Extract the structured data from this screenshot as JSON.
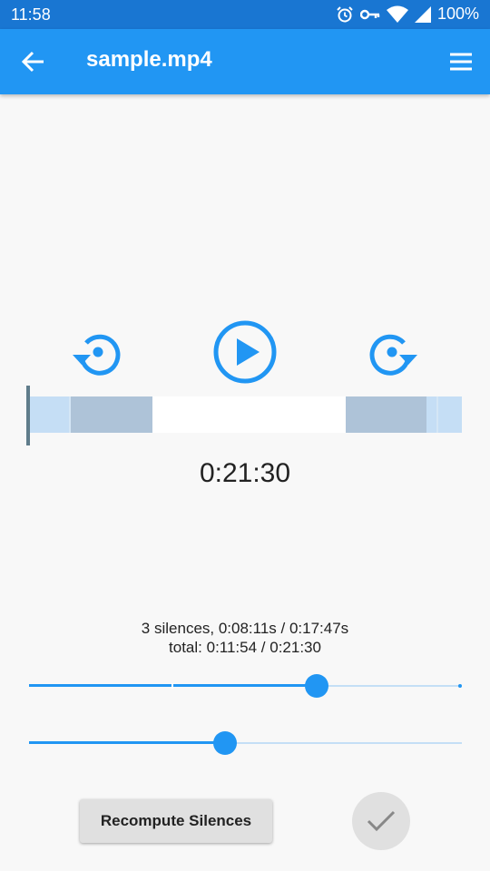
{
  "status_bar": {
    "time": "11:58",
    "battery": "100%",
    "icons": [
      "alarm-icon",
      "vpn-key-icon",
      "wifi-icon",
      "signal-icon",
      "battery-icon"
    ]
  },
  "app_bar": {
    "title": "sample.mp4",
    "back_icon": "arrow-left-icon",
    "menu_icon": "hamburger-menu-icon",
    "color": "#2196f3"
  },
  "player": {
    "controls": [
      "rewind-icon",
      "play-icon",
      "forward-icon"
    ],
    "current_time": "0:21:30",
    "accent_color": "#2196f3"
  },
  "summary": {
    "silences_line": "3 silences, 0:08:11s / 0:17:47s",
    "total_line": "total: 0:11:54 / 0:21:30"
  },
  "sliders": [
    {
      "name": "threshold",
      "value_fraction": 0.664
    },
    {
      "name": "min-duration",
      "value_fraction": 0.453
    }
  ],
  "actions": {
    "recompute_label": "Recompute Silences",
    "confirm_icon": "check-icon"
  }
}
